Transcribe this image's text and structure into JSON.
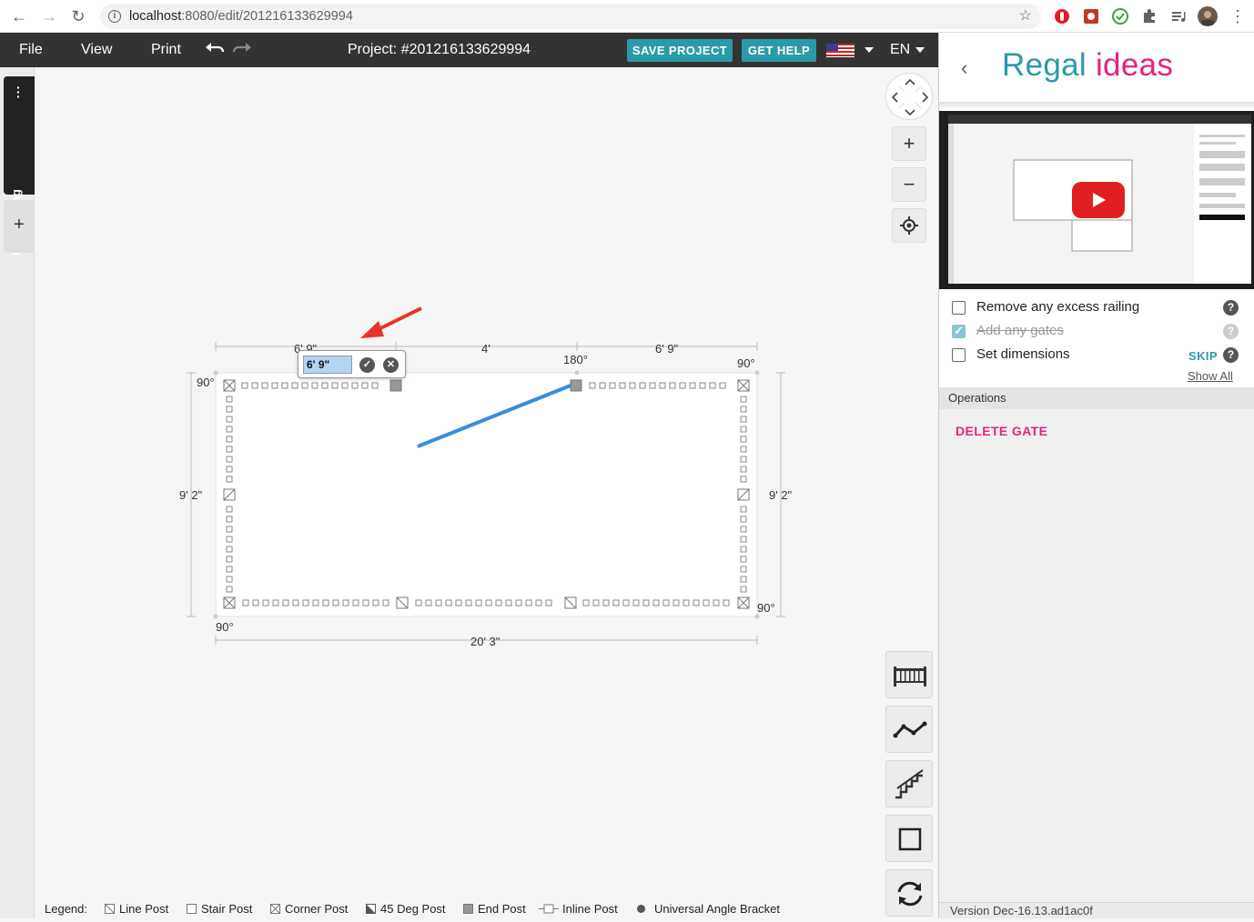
{
  "browser": {
    "url_host": "localhost",
    "url_path": ":8080/edit/201216133629994"
  },
  "toolbar": {
    "file": "File",
    "view": "View",
    "print": "Print",
    "project_title": "Project: #201216133629994",
    "save_project": "SAVE PROJECT",
    "get_help": "GET HELP",
    "language": "EN"
  },
  "left_tabs": {
    "my_drawing": "My Drawing",
    "add": "+"
  },
  "drawing": {
    "dimensions": {
      "top_left_segment": "6' 9\"",
      "top_middle_segment": "4'",
      "top_right_segment": "6' 9\"",
      "bottom_total": "20' 3\"",
      "left_side": "9' 2\"",
      "right_side": "9' 2\""
    },
    "angles": {
      "top_left": "90°",
      "top_right": "90°",
      "top_gate": "180°",
      "bottom_left": "90°",
      "bottom_right": "90°"
    },
    "edit_popup": {
      "value": "6' 9\""
    }
  },
  "legend": {
    "title": "Legend:",
    "line_post": "Line Post",
    "stair_post": "Stair Post",
    "corner_post": "Corner Post",
    "deg45_post": "45 Deg Post",
    "end_post": "End Post",
    "inline_post": "Inline Post",
    "angle_bracket": "Universal Angle Bracket"
  },
  "panel": {
    "logo_part1": "Regal",
    "logo_part2": "ideas",
    "tasks": [
      {
        "label": "Remove any excess railing",
        "done": false
      },
      {
        "label": "Add any gates",
        "done": true
      },
      {
        "label": "Set dimensions",
        "done": false
      }
    ],
    "skip": "SKIP",
    "show_all": "Show All",
    "operations_title": "Operations",
    "delete_gate": "DELETE GATE",
    "version": "Version  Dec-16.13.ad1ac0f"
  },
  "colors": {
    "accent_teal": "#2a9aa8",
    "accent_pink": "#e0267d",
    "toolbar_bg": "#333333",
    "gate_line": "#3a8be0"
  }
}
